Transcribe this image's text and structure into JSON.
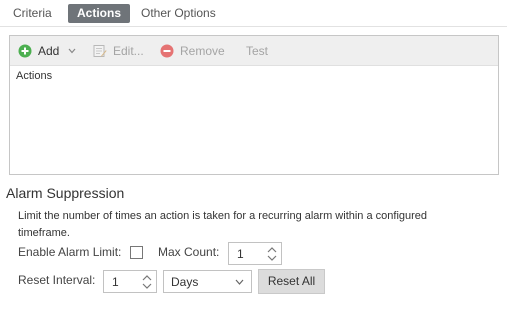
{
  "tabs": [
    {
      "label": "Criteria"
    },
    {
      "label": "Actions"
    },
    {
      "label": "Other Options"
    }
  ],
  "toolbar": {
    "add_label": "Add",
    "edit_label": "Edit...",
    "remove_label": "Remove",
    "test_label": "Test"
  },
  "actions_list": {
    "header": "Actions"
  },
  "alarm_suppression": {
    "title": "Alarm Suppression",
    "description": "Limit the number of times an action is taken for a recurring alarm within a configured timeframe.",
    "enable_label": "Enable Alarm Limit:",
    "enable_checked": false,
    "max_count_label": "Max Count:",
    "max_count_value": "1",
    "reset_interval_label": "Reset Interval:",
    "reset_interval_value": "1",
    "reset_unit": "Days",
    "reset_all_label": "Reset All"
  },
  "colors": {
    "active_tab_bg": "#6f7479",
    "add_icon_green": "#4caf50",
    "remove_icon_red": "#e57373"
  }
}
